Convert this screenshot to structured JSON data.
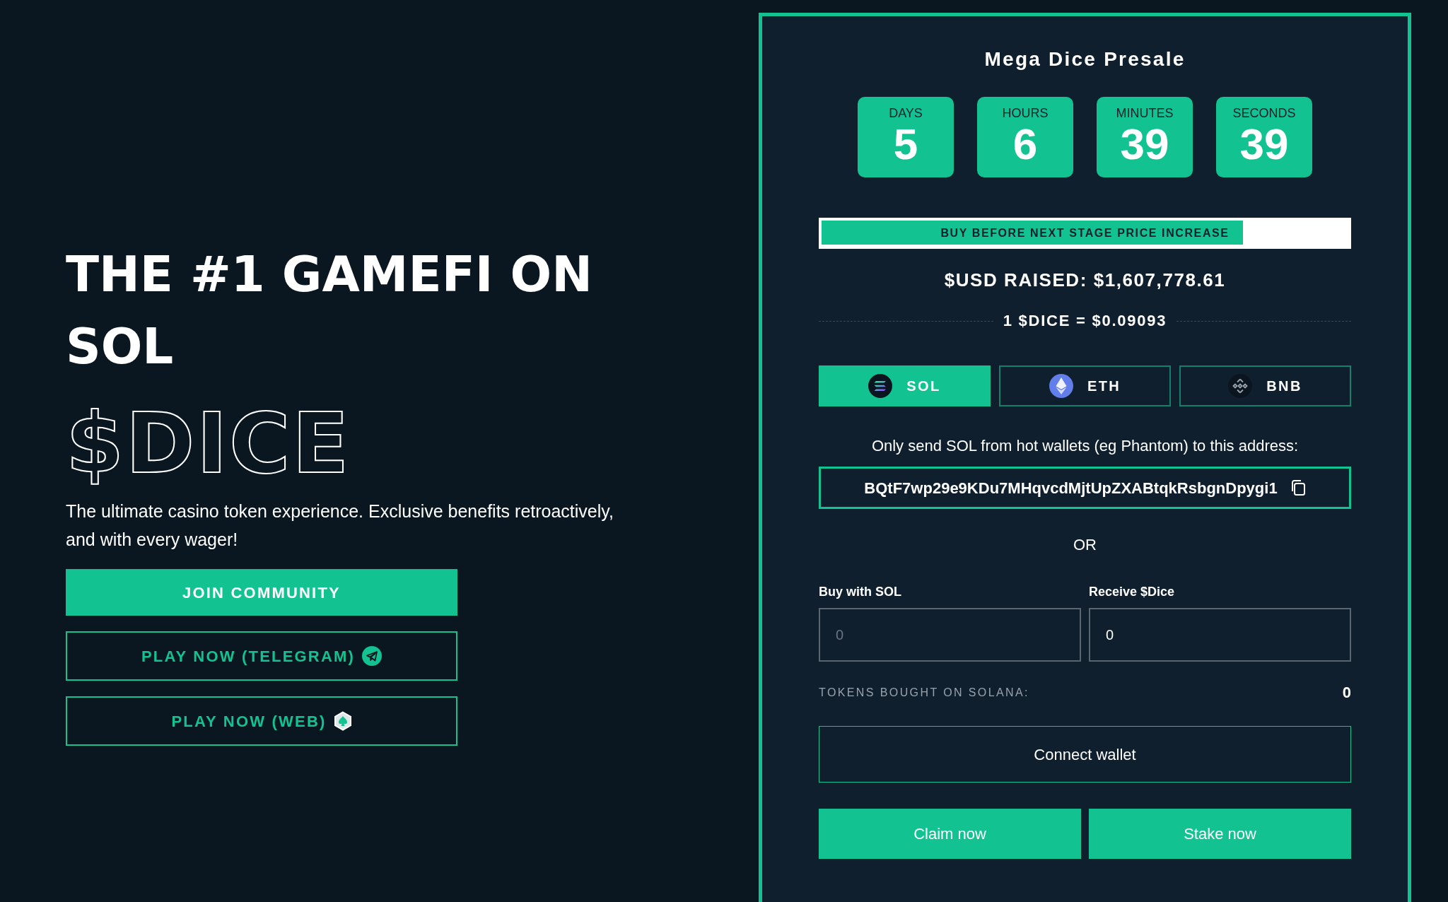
{
  "hero": {
    "heading": "THE #1 GAMEFI ON SOL",
    "token": "$DICE",
    "description": "The ultimate casino token experience. Exclusive benefits retroactively, and with every wager!",
    "buttons": [
      {
        "label": "JOIN COMMUNITY",
        "kind": "filled"
      },
      {
        "label": "PLAY NOW (TELEGRAM)",
        "kind": "outlined"
      },
      {
        "label": "PLAY NOW (WEB)",
        "kind": "outlined"
      }
    ]
  },
  "presale": {
    "title": "Mega Dice Presale",
    "countdown": [
      {
        "label": "DAYS",
        "value": "5"
      },
      {
        "label": "HOURS",
        "value": "6"
      },
      {
        "label": "MINUTES",
        "value": "39"
      },
      {
        "label": "SECONDS",
        "value": "39"
      }
    ],
    "progress": {
      "label": "BUY BEFORE NEXT STAGE PRICE INCREASE",
      "level": 0.8
    },
    "raised": "$USD RAISED: $1,607,778.61",
    "price": "1 $DICE = $0.09093",
    "currency_tabs": [
      {
        "label": "SOL",
        "selected": true
      },
      {
        "label": "ETH",
        "selected": false
      },
      {
        "label": "BNB",
        "selected": false
      }
    ],
    "instruction": "Only send SOL from hot wallets (eg Phantom) to this address:",
    "address": "BQtF7wp29e9KDu7MHqvcdMjtUpZXABtqkRsbgnDpygi1",
    "separator": "OR",
    "fields": [
      {
        "label": "Buy with SOL",
        "placeholder": "0"
      },
      {
        "label": "Receive $Dice",
        "value": "0"
      }
    ],
    "tokens_bought": {
      "label": "TOKENS BOUGHT ON SOLANA:",
      "value": "0"
    },
    "connect_button": "Connect wallet",
    "action_buttons": [
      "Claim now",
      "Stake now"
    ]
  }
}
